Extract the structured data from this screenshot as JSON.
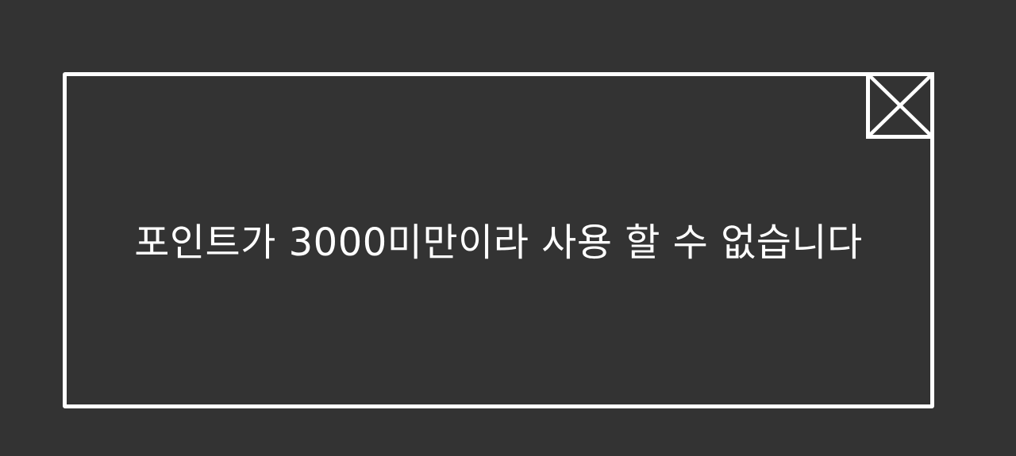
{
  "dialog": {
    "message": "포인트가 3000미만이라 사용 할 수 없습니다",
    "close_icon": "close-x-box-icon"
  },
  "colors": {
    "background": "#333333",
    "foreground": "#ffffff"
  }
}
